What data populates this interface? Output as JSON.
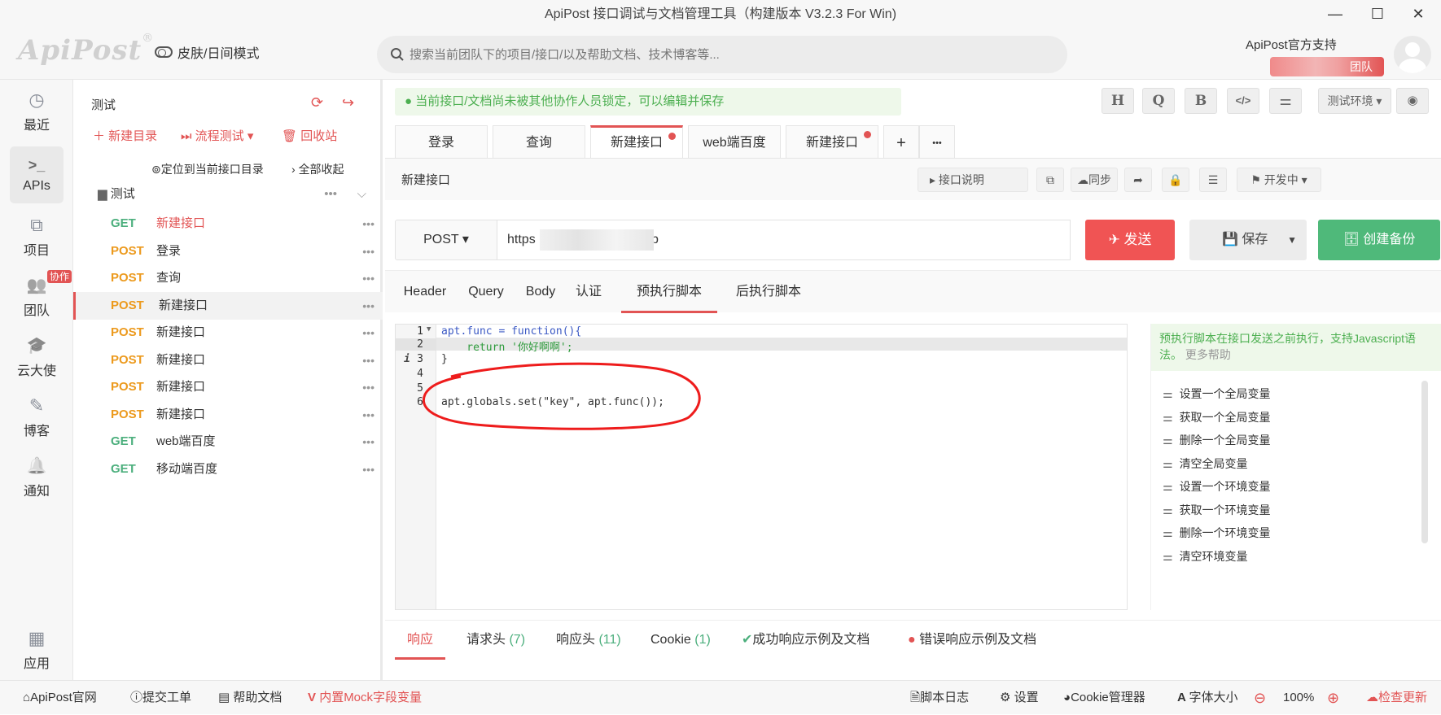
{
  "window": {
    "title": "ApiPost 接口调试与文档管理工具（构建版本 V3.2.3 For Win)",
    "minimize": "—",
    "maximize": "☐",
    "close": "✕"
  },
  "header": {
    "logo": "ApiPost",
    "logo_mark": "®",
    "skin_mode": "皮肤/日间模式",
    "search_placeholder": "搜索当前团队下的项目/接口/以及帮助文档、技术博客等...",
    "user_name": "ApiPost官方支持",
    "team_badge": "团队"
  },
  "nav": {
    "items": [
      {
        "label": "最近",
        "icon": "◷"
      },
      {
        "label": "APIs",
        "icon": ">_"
      },
      {
        "label": "项目",
        "icon": "⧉"
      },
      {
        "label": "团队",
        "icon": "👥",
        "badge": "协作"
      },
      {
        "label": "云大使",
        "icon": "🎓"
      },
      {
        "label": "博客",
        "icon": "✎"
      },
      {
        "label": "通知",
        "icon": "🔔"
      },
      {
        "label": "应用",
        "icon": "▦"
      }
    ]
  },
  "tree": {
    "project": "测试",
    "new_folder": "新建目录",
    "flow_test": "流程测试",
    "recycle": "回收站",
    "locate": "定位到当前接口目录",
    "collapse_all": "全部收起",
    "folder": "测试",
    "items": [
      {
        "method": "GET",
        "name": "新建接口"
      },
      {
        "method": "POST",
        "name": "登录"
      },
      {
        "method": "POST",
        "name": "查询"
      },
      {
        "method": "POST",
        "name": "新建接口"
      },
      {
        "method": "POST",
        "name": "新建接口"
      },
      {
        "method": "POST",
        "name": "新建接口"
      },
      {
        "method": "POST",
        "name": "新建接口"
      },
      {
        "method": "POST",
        "name": "新建接口"
      },
      {
        "method": "GET",
        "name": "web端百度"
      },
      {
        "method": "GET",
        "name": "移动端百度"
      }
    ]
  },
  "main": {
    "lock_notice": "当前接口/文档尚未被其他协作人员锁定，可以编辑并保存",
    "toolbar": {
      "h": "H",
      "q": "Q",
      "b": "B",
      "code": "</>",
      "settings": "⚌",
      "env": "测试环境",
      "eye": "◉"
    },
    "tabs": [
      {
        "label": "登录"
      },
      {
        "label": "查询"
      },
      {
        "label": "新建接口"
      },
      {
        "label": "web端百度"
      },
      {
        "label": "新建接口"
      }
    ],
    "tab_add": "+",
    "tab_more": "•••",
    "api_name": "新建接口",
    "api_doc": "接口说明",
    "sync": "同步",
    "status": "开发中",
    "method": "POST",
    "url": "https                        et.php",
    "send": "发送",
    "save": "保存",
    "backup": "创建备份",
    "subtabs": [
      "Header",
      "Query",
      "Body",
      "认证",
      "预执行脚本",
      "后执行脚本"
    ],
    "code_lines": [
      {
        "no": "1",
        "text": "apt.func = function(){"
      },
      {
        "no": "2",
        "text": "    return '你好啊啊';"
      },
      {
        "no": "3",
        "text": "}"
      },
      {
        "no": "4",
        "text": ""
      },
      {
        "no": "5",
        "text": ""
      },
      {
        "no": "6",
        "text": "apt.globals.set(\"key\", apt.func());"
      }
    ],
    "help_tip": "预执行脚本在接口发送之前执行，支持Javascript语法。",
    "help_more": "更多帮助",
    "snippets": [
      "设置一个全局变量",
      "获取一个全局变量",
      "删除一个全局变量",
      "清空全局变量",
      "设置一个环境变量",
      "获取一个环境变量",
      "删除一个环境变量",
      "清空环境变量"
    ],
    "resp_tabs": [
      {
        "label": "响应",
        "count": ""
      },
      {
        "label": "请求头",
        "count": "(7)"
      },
      {
        "label": "响应头",
        "count": "(11)"
      },
      {
        "label": "Cookie",
        "count": "(1)"
      },
      {
        "label": "成功响应示例及文档",
        "count": ""
      },
      {
        "label": "错误响应示例及文档",
        "count": ""
      }
    ]
  },
  "statusbar": {
    "site": "ApiPost官网",
    "ticket": "提交工单",
    "help": "帮助文档",
    "mock": "内置Mock字段变量",
    "script_log": "脚本日志",
    "settings": "设置",
    "cookie": "Cookie管理器",
    "font_size": "字体大小",
    "zoom": "100%",
    "update": "检查更新"
  }
}
